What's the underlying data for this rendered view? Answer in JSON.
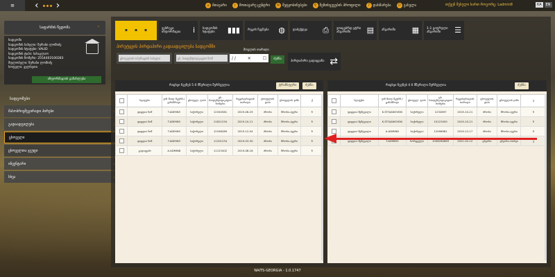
{
  "topbar": {
    "logo": "≡",
    "menu": [
      {
        "label": "მთავარი",
        "icon": "home-icon"
      },
      {
        "label": "მოთავარე ცენტრი",
        "icon": "info-icon"
      },
      {
        "label": "შეტყობინებები",
        "icon": "mail-icon"
      },
      {
        "label": "შემთხვევების პროფილი",
        "icon": "search-icon"
      },
      {
        "label": "დახმარება",
        "icon": "help-icon"
      },
      {
        "label": "გასვლა",
        "icon": "exit-icon"
      }
    ],
    "user": "თქვენ შესული ხართ როგორც: Ladmin8",
    "lang": [
      "KA",
      "EN"
    ],
    "lang_active": "KA"
  },
  "sidebar": {
    "header": "საფარმის წვდომა",
    "holding_lines": [
      "სადგომი",
      "სადგომის სახელი: ზურაბი ლომიძე",
      "სადგომის სტატუსი: VALID",
      "სადგომის ტიპი: სასაკლაო",
      "სადგომის ნომერი: 2554403100283",
      "მფლობელი: ზურაბი ლომიძე",
      "სოფელი: ველხეთი"
    ],
    "edit_button": "ინფორმაციის განახლება",
    "section_label": "სადგომები",
    "items": [
      {
        "label": "მასობრივშეგირადი პირები",
        "chevron": "›"
      },
      {
        "label": "გადაადგილება",
        "chevron": "›"
      },
      {
        "label": "ცხოველი",
        "chevron": ""
      },
      {
        "label": "ცხოველთა ჯგუფი",
        "chevron": ""
      },
      {
        "label": "ინვენტარი",
        "chevron": "›"
      },
      {
        "label": "სხვა",
        "chevron": "›"
      }
    ]
  },
  "toolbar": {
    "tools": [
      {
        "label": "ვებრეკი ინფორმაცია",
        "icon": "i"
      },
      {
        "label": "სადგომის სტატუსი",
        "icon": "▮▮▮"
      },
      {
        "label": "რუკის ჩვენება",
        "icon": "◍"
      },
      {
        "label": "დაბეჭდვა",
        "icon": "⎙"
      },
      {
        "label": "ვოიცებრდ ეტრი ანგარიში",
        "icon": "▤"
      },
      {
        "label": "ანგარიში",
        "icon": "▦"
      },
      {
        "label": "1-1 ციფრული ანგარიში",
        "icon": "☰"
      }
    ]
  },
  "main": {
    "title": "პირუტყვის პირდაპირი გადაადგილება სადგომში",
    "filter1_placeholder": "ცხოველის ოპერაციის სახელი",
    "filter2_placeholder": "ცხ. საიდენტიფიკაციო ნომ",
    "date_label": "მოვლის თარიღი",
    "date_value": "/ /",
    "search_button": "ძებნა",
    "transfer_label": "პირდაპირი გადაყვანა"
  },
  "left_table": {
    "count": "რიცხვი ჩვენებ 5   0 მწვრილი შერჩეულია",
    "btn_transfer": "ტრანსფერი",
    "btn_search": "ძებნა",
    "columns": [
      "",
      "სტატუსი",
      "ვინ მიიღ მკურნ./ განამრავი",
      "ცხოველ. ტიპი",
      "ცხ. საიდენტიფიკაციო ნომერი",
      "რეგისტრაციის თარიღი",
      "ცხოველის ტიპი",
      "ცხოველის ჯიში",
      "ქ"
    ],
    "rows": [
      [
        "",
        "ფიცდია ნიშ",
        "T.ADMIN3",
        "საქონელი",
        "12340581",
        "2019-06-29",
        "ძროხა",
        "მროსი-ავერი",
        "ნ"
      ],
      [
        "",
        "ფიცდია ნიშ",
        "T.ADMIN3",
        "საქონელი",
        "11811234",
        "2019-10-11",
        "ძროხა",
        "მროსი-ავერი",
        "ნ"
      ],
      [
        "",
        "ფიცდია ნიშ",
        "T.ADMIN3",
        "საქონელი",
        "12348289",
        "2019-12-04",
        "ძროხა",
        "მროსი-ავერი",
        "ნ"
      ],
      [
        "",
        "ფიცდია ნიშ",
        "T.ADMIN3",
        "საქონელი",
        "11201234",
        "2019-03-30",
        "ძროხა",
        "მროსი-ავერი",
        "ნ"
      ],
      [
        "",
        "გადაყვარ",
        "A.ADMIN8",
        "საქონელი",
        "11123402",
        "2019-08-18",
        "ძროხა",
        "მროსი-ავერი",
        "ნ"
      ]
    ]
  },
  "right_table": {
    "count": "რიცხვი ჩვენებ 4   0 მწვრილი შერჩეულია",
    "btn_search": "ძებნა",
    "columns": [
      "",
      "სტატუსი",
      "ვინ მიიღ მკურნ./ განამრავი",
      "ცხოველ. ტიპი",
      "ცხ. საიდენტიფიკაციო ნომერი",
      "რეგისტრაციის თარიღი",
      "ცხოველის ტიპი",
      "ცხოველის ჯიში",
      "ე"
    ],
    "rows": [
      [
        "",
        "ფიცდია შეშტვილი",
        "K.STOJANOVSKI",
        "საქონელი",
        "1232897",
        "2019-10-21",
        "ძროხა",
        "მროსი-ავერი",
        "ნ"
      ],
      [
        "",
        "ფიცდია შეშტვილი",
        "K.STOJANOVSKI",
        "საქონელი",
        "10123450",
        "2019-10-21",
        "ძროხა",
        "მროსი-ავერი",
        "ნ"
      ],
      [
        "",
        "ფიცდია შეშტვილი",
        "A.ADMIN8",
        "საქონელი",
        "12098981",
        "2019-12-17",
        "ძროხა",
        "მროსი-ავერი",
        "ნ"
      ],
      [
        "",
        "ფიცდია შეშტვილი",
        "T.ADMIN3",
        "ხორცეული",
        "1008280683",
        "2021-02-12",
        "ცხვარი",
        "ცხვარი-ოთხვი",
        "ე"
      ]
    ]
  },
  "footer": "NAITS-GEORGIA - 1.0.1747"
}
